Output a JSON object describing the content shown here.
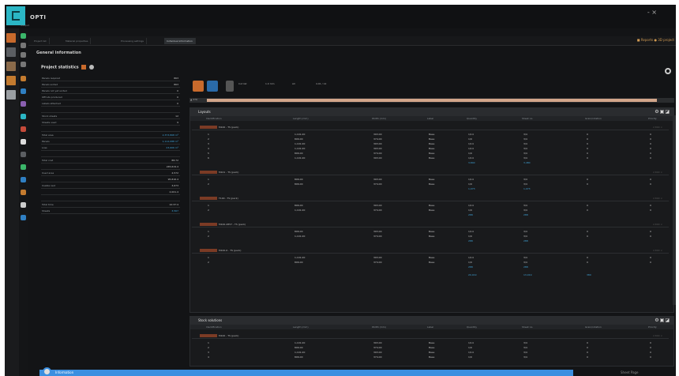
{
  "app": {
    "title": "OPTI",
    "subtitle": "Geepet",
    "window_controls": "- ×"
  },
  "tabs": [
    "Project list",
    "Material properties",
    "Processing settings",
    "Individual information"
  ],
  "tab_right": "■ Reports  ● 3D project",
  "section_header": "General information",
  "project_statistics": "Project statistics",
  "left_panel": [
    {
      "label": "Panels required",
      "value": "863"
    },
    {
      "label": "Panels sorted",
      "value": "863"
    },
    {
      "label": "Panels not yet sorted",
      "value": "0"
    },
    {
      "label": "Offcuts produced",
      "value": "0"
    },
    {
      "label": "Labels attached",
      "value": "0"
    },
    {
      "label": "",
      "value": ""
    },
    {
      "label": "Stock sheets",
      "value": "12"
    },
    {
      "label": "Sheets used",
      "value": "9"
    },
    {
      "label": "",
      "value": ""
    },
    {
      "label": "Total area",
      "value": "2,373,868 m²",
      "blue": true
    },
    {
      "label": "Panels",
      "value": "1,112,088 m²",
      "blue": true
    },
    {
      "label": "Loss",
      "value": "23,606 m²",
      "blue": true
    },
    {
      "label": "",
      "value": ""
    },
    {
      "label": "Total cost",
      "value": "88.72"
    },
    {
      "label": "",
      "value": "245,619.4"
    },
    {
      "label": "Used area",
      "value": "4,572"
    },
    {
      "label": "",
      "value": "95,816.4"
    },
    {
      "label": "Usable rest",
      "value": "3,673"
    },
    {
      "label": "",
      "value": "2,001.4"
    },
    {
      "label": "",
      "value": ""
    },
    {
      "label": "Total time",
      "value": "10:37:4"
    },
    {
      "label": "Sheets",
      "value": "3,567",
      "blue": true
    }
  ],
  "toolbar": {
    "zoom": "▲ 376",
    "labels": [
      "Cut list",
      "1.0 mm",
      "All",
      "4.01 / 12"
    ]
  },
  "panels": {
    "main": {
      "title": "Layouts",
      "columns": [
        "Identification",
        "Length (mm)",
        "Width (mm)",
        "Label",
        "Quantity",
        "Sheet no.",
        "Grain/rotation",
        "Priority"
      ],
      "groups": [
        {
          "name": "M100 - TS (pack)",
          "right": "2,800 ×",
          "rows": [
            [
              "1",
              "1,101.00",
              "393.00",
              "Base",
              "1/14",
              "3/4",
              "0",
              "0"
            ],
            [
              "2",
              "806.00",
              "374.00",
              "Base",
              "1/9",
              "3/4",
              "0",
              "0"
            ],
            [
              "3",
              "1,101.00",
              "393.00",
              "Base",
              "1/14",
              "3/4",
              "0",
              "0"
            ],
            [
              "4",
              "1,101.00",
              "393.00",
              "Base",
              "1/14",
              "3/4",
              "0",
              "0"
            ],
            [
              "5",
              "806.00",
              "374.00",
              "Base",
              "1/9",
              "3/4",
              "0",
              "0"
            ],
            [
              "6",
              "1,101.00",
              "393.00",
              "Base",
              "1/14",
              "3/4",
              "0",
              "0"
            ]
          ],
          "totals": [
            "3,840",
            "3,480"
          ]
        },
        {
          "name": "M101 - TS (pack)",
          "right": "2,800 ×",
          "rows": [
            [
              "1",
              "806.00",
              "393.00",
              "Base",
              "1/14",
              "3/4",
              "0",
              "0"
            ],
            [
              "2",
              "806.00",
              "374.00",
              "Base",
              "1/9",
              "3/4",
              "0",
              "0"
            ]
          ],
          "totals": [
            "1,073",
            "1,073"
          ]
        },
        {
          "name": "T100 - TS (pack)",
          "right": "2,800 ×",
          "rows": [
            [
              "1",
              "806.00",
              "393.00",
              "Base",
              "1/14",
              "3/4",
              "0",
              "0"
            ],
            [
              "2",
              "1,101.00",
              "374.00",
              "Base",
              "1/9",
              "3/4",
              "0",
              "0"
            ]
          ],
          "totals": [
            "288",
            "288"
          ]
        },
        {
          "name": "M100-2857 - TS (pack)",
          "right": "2,800 ×",
          "rows": [
            [
              "1",
              "806.00",
              "393.00",
              "Base",
              "1/14",
              "3/4",
              "0",
              "0"
            ],
            [
              "2",
              "1,101.00",
              "374.00",
              "Base",
              "1/9",
              "3/4",
              "0",
              "0"
            ]
          ],
          "totals": [
            "288",
            "288"
          ]
        },
        {
          "name": "M100-6 - TS (pack)",
          "right": "2,800 ×",
          "rows": [
            [
              "1",
              "1,101.00",
              "393.00",
              "Base",
              "1/14",
              "3/4",
              "0",
              "0"
            ],
            [
              "2",
              "806.00",
              "374.00",
              "Base",
              "1/9",
              "3/4",
              "0",
              "0"
            ]
          ],
          "totals": [
            "288",
            "288"
          ]
        }
      ],
      "grand_total": [
        "20,019",
        "13,019",
        "380"
      ]
    },
    "second": {
      "title": "Stock solutions",
      "columns": [
        "Identification",
        "Length (mm)",
        "Width (mm)",
        "Label",
        "Quantity",
        "Sheet no.",
        "Grain/rotation",
        "Priority"
      ],
      "groups": [
        {
          "name": "M100 - TS (pack)",
          "right": "2,800 ×",
          "rows": [
            [
              "1",
              "1,101.00",
              "393.00",
              "Base",
              "1/14",
              "3/4",
              "0",
              "0"
            ],
            [
              "2",
              "806.00",
              "374.00",
              "Base",
              "1/9",
              "3/4",
              "0",
              "0"
            ],
            [
              "3",
              "1,101.00",
              "393.00",
              "Base",
              "1/14",
              "3/4",
              "0",
              "0"
            ],
            [
              "4",
              "806.00",
              "374.00",
              "Base",
              "1/9",
              "3/4",
              "0",
              "0"
            ]
          ]
        }
      ]
    }
  },
  "bottom": {
    "text": "Information",
    "right": "Sheet    Page"
  },
  "colors": {
    "accent": "#3b8fe0",
    "swatch": "#7b3b25",
    "progress": "#d2a58a",
    "logo": "#2bb6c5"
  }
}
